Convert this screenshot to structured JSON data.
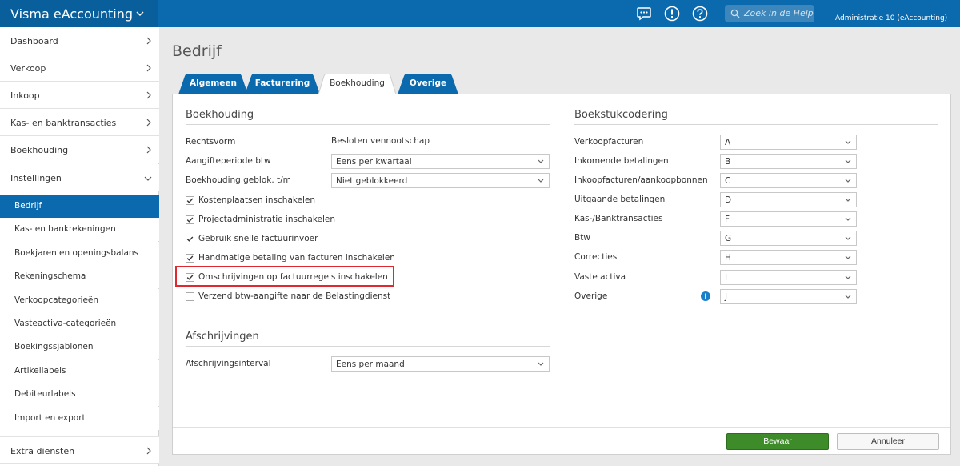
{
  "app": {
    "title": "Visma eAccounting",
    "search_placeholder": "Zoek in de Help",
    "administration": "Administratie 10 (eAccounting)",
    "accent_color": "#0a6aad",
    "icons": [
      "chat-icon",
      "alert-icon",
      "help-icon",
      "search-icon"
    ]
  },
  "sidebar": {
    "items": [
      {
        "label": "Dashboard"
      },
      {
        "label": "Verkoop"
      },
      {
        "label": "Inkoop"
      },
      {
        "label": "Kas- en banktransacties"
      },
      {
        "label": "Boekhouding"
      },
      {
        "label": "Instellingen"
      }
    ],
    "sub_items": [
      {
        "label": "Bedrijf",
        "active": true
      },
      {
        "label": "Kas- en bankrekeningen"
      },
      {
        "label": "Boekjaren en openingsbalans"
      },
      {
        "label": "Rekeningschema"
      },
      {
        "label": "Verkoopcategorieën"
      },
      {
        "label": "Vasteactiva-categorieën"
      },
      {
        "label": "Boekingssjablonen"
      },
      {
        "label": "Artikellabels"
      },
      {
        "label": "Debiteurlabels"
      },
      {
        "label": "Import en export"
      }
    ],
    "bottom_item": {
      "label": "Extra diensten"
    }
  },
  "page": {
    "title": "Bedrijf",
    "tabs": [
      {
        "label": "Algemeen"
      },
      {
        "label": "Facturering"
      },
      {
        "label": "Boekhouding",
        "active": true
      },
      {
        "label": "Overige"
      }
    ]
  },
  "boekhouding": {
    "title": "Boekhouding",
    "rechtsvorm": {
      "label": "Rechtsvorm",
      "value": "Besloten vennootschap"
    },
    "aangifteperiode": {
      "label": "Aangifteperiode btw",
      "value": "Eens per kwartaal"
    },
    "geblokkeerd": {
      "label": "Boekhouding geblok. t/m",
      "value": "Niet geblokkeerd"
    },
    "checkboxes": [
      {
        "label": "Kostenplaatsen inschakelen",
        "checked": true
      },
      {
        "label": "Projectadministratie inschakelen",
        "checked": true
      },
      {
        "label": "Gebruik snelle factuurinvoer",
        "checked": true
      },
      {
        "label": "Handmatige betaling van facturen inschakelen",
        "checked": true
      },
      {
        "label": "Omschrijvingen op factuurregels inschakelen",
        "checked": true,
        "highlighted": true
      },
      {
        "label": "Verzend btw-aangifte naar de Belastingdienst",
        "checked": false
      }
    ]
  },
  "afschrijvingen": {
    "title": "Afschrijvingen",
    "interval": {
      "label": "Afschrijvingsinterval",
      "value": "Eens per maand"
    }
  },
  "boekstukcodering": {
    "title": "Boekstukcodering",
    "rows": [
      {
        "label": "Verkoopfacturen",
        "value": "A"
      },
      {
        "label": "Inkomende betalingen",
        "value": "B"
      },
      {
        "label": "Inkoopfacturen/aankoopbonnen",
        "value": "C"
      },
      {
        "label": "Uitgaande betalingen",
        "value": "D"
      },
      {
        "label": "Kas-/Banktransacties",
        "value": "F"
      },
      {
        "label": "Btw",
        "value": "G"
      },
      {
        "label": "Correcties",
        "value": "H"
      },
      {
        "label": "Vaste activa",
        "value": "I"
      },
      {
        "label": "Overige",
        "value": "J",
        "info": true
      }
    ]
  },
  "buttons": {
    "save": "Bewaar",
    "cancel": "Annuleer"
  }
}
